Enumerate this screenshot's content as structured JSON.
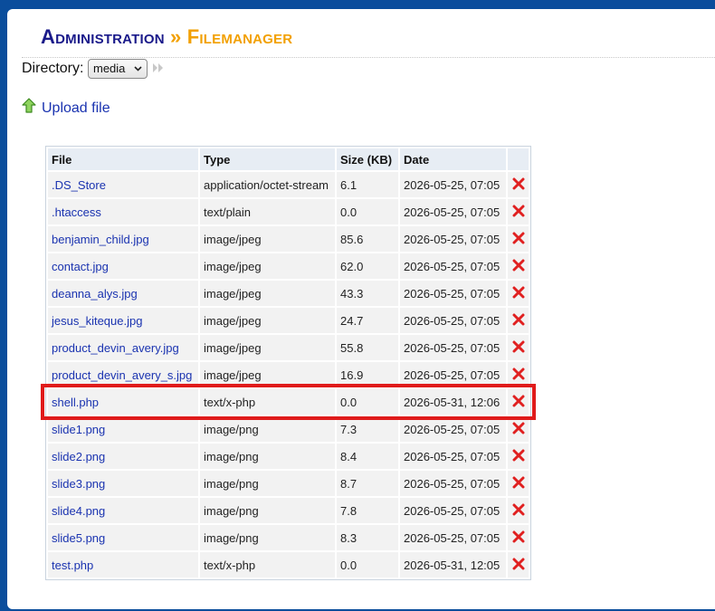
{
  "header": {
    "admin_label": "Administration",
    "separator": "»",
    "page_label": "Filemanager"
  },
  "directory": {
    "label": "Directory:",
    "selected": "media"
  },
  "upload": {
    "label": "Upload file",
    "icon": "up-arrow-icon"
  },
  "table": {
    "columns": [
      "File",
      "Type",
      "Size (KB)",
      "Date",
      ""
    ],
    "rows": [
      {
        "file": ".DS_Store",
        "type": "application/octet-stream",
        "size": "6.1",
        "date": "2026-05-25, 07:05"
      },
      {
        "file": ".htaccess",
        "type": "text/plain",
        "size": "0.0",
        "date": "2026-05-25, 07:05"
      },
      {
        "file": "benjamin_child.jpg",
        "type": "image/jpeg",
        "size": "85.6",
        "date": "2026-05-25, 07:05"
      },
      {
        "file": "contact.jpg",
        "type": "image/jpeg",
        "size": "62.0",
        "date": "2026-05-25, 07:05"
      },
      {
        "file": "deanna_alys.jpg",
        "type": "image/jpeg",
        "size": "43.3",
        "date": "2026-05-25, 07:05"
      },
      {
        "file": "jesus_kiteque.jpg",
        "type": "image/jpeg",
        "size": "24.7",
        "date": "2026-05-25, 07:05"
      },
      {
        "file": "product_devin_avery.jpg",
        "type": "image/jpeg",
        "size": "55.8",
        "date": "2026-05-25, 07:05"
      },
      {
        "file": "product_devin_avery_s.jpg",
        "type": "image/jpeg",
        "size": "16.9",
        "date": "2026-05-25, 07:05"
      },
      {
        "file": "shell.php",
        "type": "text/x-php",
        "size": "0.0",
        "date": "2026-05-31, 12:06"
      },
      {
        "file": "slide1.png",
        "type": "image/png",
        "size": "7.3",
        "date": "2026-05-25, 07:05"
      },
      {
        "file": "slide2.png",
        "type": "image/png",
        "size": "8.4",
        "date": "2026-05-25, 07:05"
      },
      {
        "file": "slide3.png",
        "type": "image/png",
        "size": "8.7",
        "date": "2026-05-25, 07:05"
      },
      {
        "file": "slide4.png",
        "type": "image/png",
        "size": "7.8",
        "date": "2026-05-25, 07:05"
      },
      {
        "file": "slide5.png",
        "type": "image/png",
        "size": "8.3",
        "date": "2026-05-25, 07:05"
      },
      {
        "file": "test.php",
        "type": "text/x-php",
        "size": "0.0",
        "date": "2026-05-31, 12:05"
      }
    ]
  },
  "highlight_row_index": 8,
  "colors": {
    "page_background": "#0a4d9c",
    "title_primary": "#1a1a8a",
    "title_accent": "#f2a000",
    "link": "#1a33b0",
    "delete": "#e02020",
    "highlight": "#e01b1b"
  }
}
